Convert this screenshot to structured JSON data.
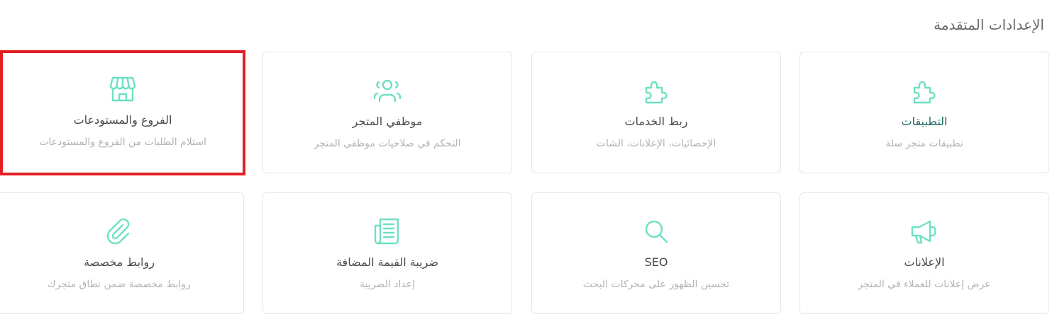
{
  "section_title": "الإعدادات المتقدمة",
  "colors": {
    "icon": "#6ee0c3",
    "accent_title": "#1e6b62",
    "highlight_border": "#e31e24"
  },
  "cards": [
    {
      "title": "التطبيقات",
      "description": "تطبيقات متجر سلة",
      "icon": "puzzle-icon"
    },
    {
      "title": "ربط الخدمات",
      "description": "الإحصائيات، الإعلانات، الشات",
      "icon": "puzzle-icon"
    },
    {
      "title": "موظفي المتجر",
      "description": "التحكم في صلاحيات موظفي المتجر",
      "icon": "users-icon"
    },
    {
      "title": "الفروع والمستودعات",
      "description": "استلام الطلبات من الفروع والمستودعات",
      "icon": "store-icon"
    },
    {
      "title": "الإعلانات",
      "description": "عرض إعلانات للعملاء في المتجر",
      "icon": "megaphone-icon"
    },
    {
      "title": "SEO",
      "description": "تحسين الظهور على محركات البحث",
      "icon": "search-icon"
    },
    {
      "title": "ضريبة القيمة المضافة",
      "description": "إعداد الضريبة",
      "icon": "receipt-icon"
    },
    {
      "title": "روابط مخصصة",
      "description": "روابط مخصصة ضمن نطاق متجرك",
      "icon": "paperclip-icon"
    }
  ]
}
